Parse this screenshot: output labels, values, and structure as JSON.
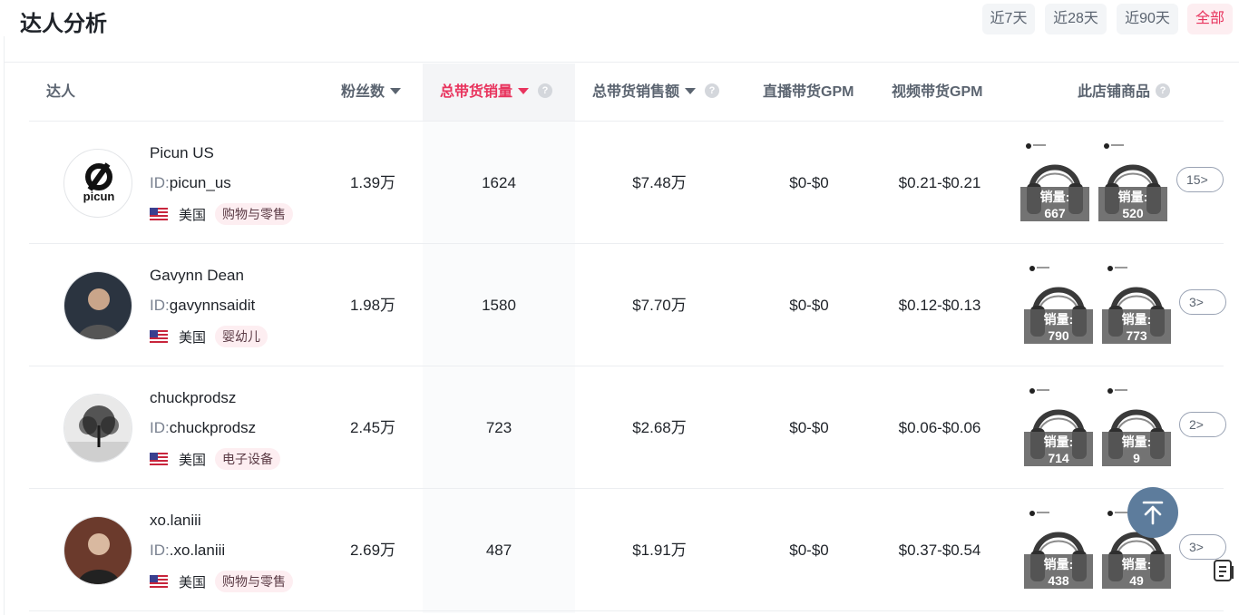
{
  "page": {
    "title": "达人分析",
    "ranges": [
      "近7天",
      "近28天",
      "近90天",
      "全部"
    ],
    "active_range": "全部"
  },
  "colors": {
    "accent": "#e8345e",
    "header_text": "#5b6470",
    "tag_bg": "#fdeef1",
    "back_top": "#5d7c9c"
  },
  "table": {
    "headers": {
      "creator": "达人",
      "followers": "粉丝数",
      "total_units": "总带货销量",
      "total_sales": "总带货销售额",
      "live_gpm": "直播带货GPM",
      "video_gpm": "视频带货GPM",
      "store_products": "此店铺商品"
    },
    "sold_label": "销量:",
    "rows": [
      {
        "name": "Picun US",
        "id_label": "ID:",
        "id": "picun_us",
        "avatar": "picun-logo",
        "avatar_text": "picun",
        "country": "美国",
        "category": "购物与零售",
        "followers": "1.39万",
        "units": "1624",
        "sales": "$7.48万",
        "live_gpm": "$0-$0",
        "video_gpm": "$0.21-$0.21",
        "products": [
          {
            "sold": "667"
          },
          {
            "sold": "520"
          }
        ],
        "more": "15"
      },
      {
        "name": "Gavynn Dean",
        "id_label": "ID:",
        "id": "gavynnsaidit",
        "avatar": "person-photo",
        "country": "美国",
        "category": "婴幼儿",
        "followers": "1.98万",
        "units": "1580",
        "sales": "$7.70万",
        "live_gpm": "$0-$0",
        "video_gpm": "$0.12-$0.13",
        "products": [
          {
            "sold": "790"
          },
          {
            "sold": "773"
          }
        ],
        "more": "3"
      },
      {
        "name": "chuckprodsz",
        "id_label": "ID:",
        "id": "chuckprodsz",
        "avatar": "tree-photo",
        "country": "美国",
        "category": "电子设备",
        "followers": "2.45万",
        "units": "723",
        "sales": "$2.68万",
        "live_gpm": "$0-$0",
        "video_gpm": "$0.06-$0.06",
        "products": [
          {
            "sold": "714"
          },
          {
            "sold": "9"
          }
        ],
        "more": "2"
      },
      {
        "name": "xo.laniii",
        "id_label": "ID:",
        "id": ".xo.laniii",
        "avatar": "person-photo",
        "country": "美国",
        "category": "购物与零售",
        "followers": "2.69万",
        "units": "487",
        "sales": "$1.91万",
        "live_gpm": "$0-$0",
        "video_gpm": "$0.37-$0.54",
        "products": [
          {
            "sold": "438"
          },
          {
            "sold": "49"
          }
        ],
        "more": "3"
      }
    ]
  },
  "widgets": {
    "back_to_top": "arrow-up-icon",
    "document": "document-list-icon"
  }
}
